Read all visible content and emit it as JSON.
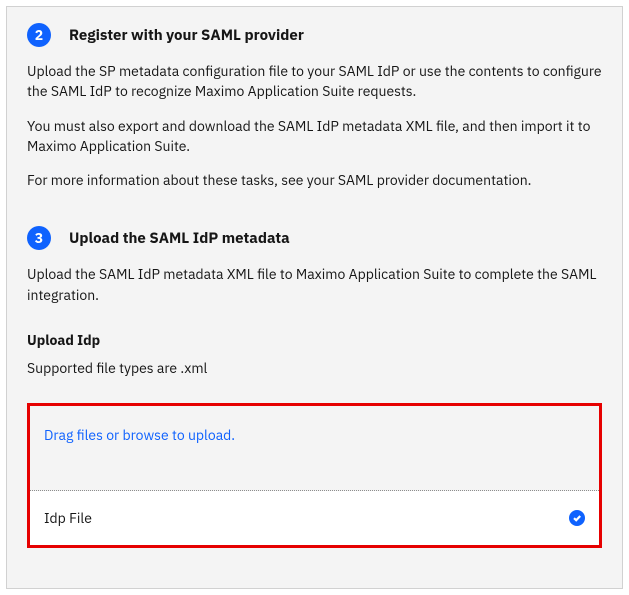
{
  "steps": [
    {
      "number": "2",
      "title": "Register with your SAML provider",
      "paragraphs": [
        "Upload the SP metadata configuration file to your SAML IdP or use the contents to configure the SAML IdP to recognize Maximo Application Suite requests.",
        "You must also export and download the SAML IdP metadata XML file, and then import it to Maximo Application Suite.",
        "For more information about these tasks, see your SAML provider documentation."
      ]
    },
    {
      "number": "3",
      "title": "Upload the SAML IdP metadata",
      "paragraphs": [
        "Upload the SAML IdP metadata XML file to Maximo Application Suite to complete the SAML integration."
      ]
    }
  ],
  "upload": {
    "label": "Upload Idp",
    "helper": "Supported file types are .xml",
    "drop_text": "Drag files or browse to upload.",
    "file_name": "Idp File"
  }
}
